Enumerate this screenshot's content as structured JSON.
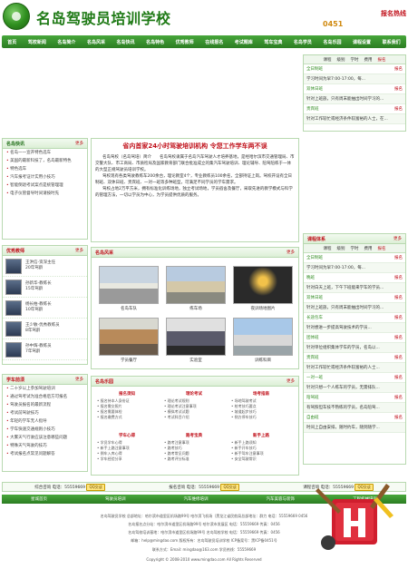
{
  "header": {
    "title": "名岛驾驶员培训学校",
    "slogan": "0451",
    "hotline": "报名热线"
  },
  "nav": [
    "首页",
    "驾校新闻",
    "名岛简介",
    "名岛风采",
    "名岛快讯",
    "名岛特色",
    "优秀教师",
    "在线报名",
    "考试题库",
    "驾车宝典",
    "名岛学员",
    "名岛乐园",
    "课程设置",
    "联系我们"
  ],
  "right_top": {
    "tabs": [
      "课程",
      "级别",
      "学时",
      "费用",
      "报名"
    ],
    "rows": [
      {
        "text": "全日制班",
        "action": "报名"
      },
      {
        "text": "学习时间为早7:00-17:00，每...",
        "action": ""
      },
      {
        "text": "双休日班",
        "action": "报名"
      },
      {
        "text": "针对上班族，只有周末能抽出时间学习的...",
        "action": ""
      },
      {
        "text": "贵宾班",
        "action": "报名"
      },
      {
        "text": "针对工作较忙或经济条件较富裕的人士，在...",
        "action": ""
      }
    ]
  },
  "news": {
    "title": "名岛快讯",
    "more": "更多",
    "items": [
      "名岛一一宣开特色选车",
      "美国的最新科技了，名岛最新特色",
      "特色选车",
      "汽车报考证计实用小技巧",
      "智能倒退考试案点是统管理理",
      "电子仪管督导时间请按时先"
    ]
  },
  "feature": {
    "title": "省内首家24小时驾驶培训机构 令您工作学车两不误",
    "paragraphs": [
      "名岛驾校（名岛驾培）简介　　名岛驾校隶属于名岛汽车驾驶人才培养基地，是经哈尔滨市交通管理局、市交警大队、市工商局、市质检局及国家教育部门联合批准成立的集汽车驾驶培训、理论辅导、陪驾陪练于一体的大型正规驾驶员培训学校。",
      "驾校现有各类驾驶教练车200余台，理论教室4个，专业教练员100余名，全部持证上岗。驾校开设有全日制班、双休日班、贵宾班、一对一班等多种班型，可满足不同学员的学车需求。",
      "驾校占地2万平方米，拥有标准化训练场地，独立考试场地，学员宿舍及餐厅，采取先进的教学模式与科学的管理方法，一切以学员为中心，为学员提供优质的服务。"
    ]
  },
  "teachers": {
    "title": "优秀教师",
    "more": "更多",
    "items": [
      {
        "name": "王洪信-资深主任",
        "info": "20年驾龄"
      },
      {
        "name": "孙新华-教练长",
        "info": "15年驾龄"
      },
      {
        "name": "杨长柏-教练长",
        "info": "10年驾龄"
      },
      {
        "name": "王少敏-优秀教练员",
        "info": "8年驾龄"
      },
      {
        "name": "孙中辉-教练员",
        "info": "7年驾龄"
      }
    ]
  },
  "gallery": {
    "title": "名岛风采",
    "more": "更多",
    "photos": [
      "名岛车队",
      "练车场",
      "夜训场地图片",
      "学员餐厅",
      "实验室",
      "训练科目"
    ]
  },
  "right_mid": {
    "title": "课程体系",
    "more": "更多",
    "tabs": [
      "课程",
      "级别",
      "学时",
      "费用",
      "报名"
    ],
    "rows": [
      {
        "text": "全日制班",
        "action": "报名"
      },
      {
        "text": "学习时间为早7:00-17:00，每...",
        "action": ""
      },
      {
        "text": "晚班",
        "action": "报名"
      },
      {
        "text": "针对白天上班，下午下班能来学车的学员...",
        "action": ""
      },
      {
        "text": "双休日班",
        "action": "报名"
      },
      {
        "text": "针对上班族，只有周末能抽出时间学习的...",
        "action": ""
      },
      {
        "text": "长途包车",
        "action": "报名"
      },
      {
        "text": "针对想进一步提高驾驶技术的学员...",
        "action": ""
      },
      {
        "text": "团体班",
        "action": "报名"
      },
      {
        "text": "针对单位组织集体学车的学员，名岛以...",
        "action": ""
      },
      {
        "text": "贵宾班",
        "action": "报名"
      },
      {
        "text": "针对工作较忙或经济条件较富裕的人士...",
        "action": ""
      },
      {
        "text": "一对一班",
        "action": "报名"
      },
      {
        "text": "针对只想一个人练车的学员，无需排队...",
        "action": ""
      },
      {
        "text": "陪驾班",
        "action": "报名"
      },
      {
        "text": "有驾照但车技不熟练的学员，名岛陪驾...",
        "action": ""
      },
      {
        "text": "自由班",
        "action": "报名"
      },
      {
        "text": "时间上自由安排，随时约车，随到随学...",
        "action": ""
      }
    ]
  },
  "tips": {
    "title": "学车前须",
    "more": "更多",
    "items": [
      "二十岁以上参加驾驶培训",
      "通过驾考试为准合格后方可报名",
      "驾驶员报名的最新流程",
      "考试前驾驶技巧",
      "年轻的学车无人指导",
      "学车快速交通规则小技巧",
      "大雾天气行驶应该注意哪些问题",
      "特殊天气驾驶的技巧",
      "考试报名点常见问题解答"
    ]
  },
  "club": {
    "title": "名岛乐园",
    "more": "更多",
    "columns": [
      {
        "title": "报名须知",
        "items": [
          "报名持本人身份证",
          "报名需交照片",
          "报名需要体检",
          "报名缴费方式"
        ]
      },
      {
        "title": "理论考试",
        "items": [
          "理论考试规则",
          "理论考试注意事项",
          "模拟考试试题",
          "考试科目介绍"
        ]
      },
      {
        "title": "场考指南",
        "items": [
          "场地驾驶考试",
          "桩考技巧要点",
          "坡道起步技巧",
          "侧方停车技巧"
        ]
      },
      {
        "title": "学车心得",
        "items": [
          "学员学车心得",
          "新手上路注意事项",
          "倒车入库心得",
          "学车经验分享"
        ]
      },
      {
        "title": "路考宝典",
        "items": [
          "路考注意事项",
          "路考技巧",
          "路考常见问题",
          "路考评分标准"
        ]
      },
      {
        "title": "新手上路",
        "items": [
          "新手上路须知",
          "新手开车技巧",
          "新手驾车注意事项",
          "安全驾驶常识"
        ]
      }
    ]
  },
  "contact_bar": [
    {
      "label": "综合咨询 电话：55559669",
      "qq": "QQ交谈"
    },
    {
      "label": "报名咨询 电话：55559669",
      "qq": "QQ交谈"
    },
    {
      "label": "课程咨询 电话：55559669",
      "qq": "QQ交谈"
    }
  ],
  "links": [
    "星城首页",
    "驾驶员培训",
    "汽车维修培训",
    "汽车美容与装饰",
    "工程机械培训"
  ],
  "footer": {
    "lines": [
      "名岛驾驶员学校 总部地址：哈尔滨市道里区机场路99号 哈尔滨飞机场（黑龙江省民航局总部地址：群力 电话：55559669 0456",
      "名岛报名点分站：哈尔滨市道里区机场路99号 哈尔滨市发展区 电话：55559669 传真：0456",
      "名岛驾校培训基地：哈尔滨市道里区机场路99号 名岛驾校学校 电话：55559669 传真：0456",
      "邮箱：help@mingdao.com 版权所有：名岛驾驶员培训学校 ICP备案号：黑ICP备0451号",
      "联系方式：Email: mingdao@163.com 学员热线：55559669",
      "Copyright © 2008-2010 www.mingdao.com All Rights Reserved"
    ]
  }
}
